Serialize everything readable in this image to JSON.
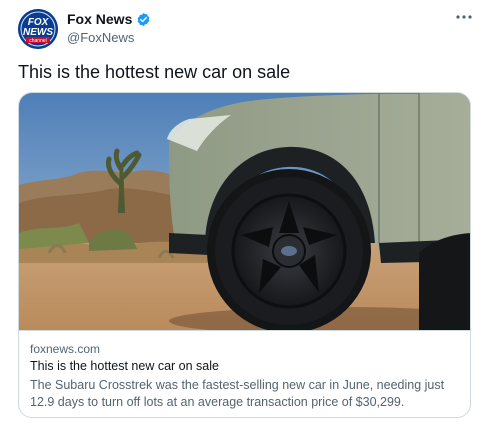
{
  "author": {
    "name": "Fox News",
    "handle": "@FoxNews",
    "verified": true,
    "avatar_icon": "fox-news-logo",
    "avatar_text": [
      "FOX",
      "NEWS",
      "channel"
    ]
  },
  "tweet": {
    "text": "This is the hottest new car on sale"
  },
  "menu_icon": "more-options-icon",
  "card": {
    "image_icon": "subaru-crosstrek-desert-photo",
    "domain": "foxnews.com",
    "title": "This is the hottest new car on sale",
    "description": "The Subaru Crosstrek was the fastest-selling new car in June, needing just 12.9 days to turn off lots at an average transaction price of $30,299."
  },
  "colors": {
    "verified": "#1d9bf0",
    "secondary_text": "#536471",
    "border": "#cfd9de",
    "brand": "#0a3d91"
  }
}
